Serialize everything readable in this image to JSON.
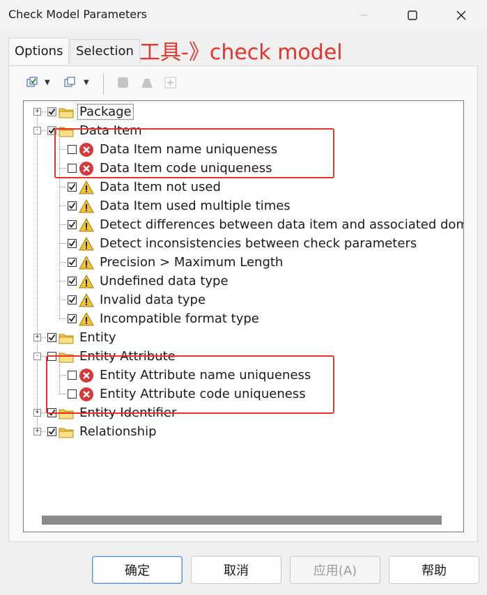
{
  "window": {
    "title": "Check Model Parameters",
    "controls": {
      "minimize": "—",
      "maximize": "☐",
      "close": "✕"
    }
  },
  "tabs": [
    {
      "label": "Options",
      "active": true
    },
    {
      "label": "Selection",
      "active": false
    }
  ],
  "annotation": "工具-》check model",
  "toolbar": {
    "items": [
      "check-all-icon",
      "uncheck-all-icon",
      "stop-icon",
      "triangle-icon",
      "add-icon"
    ]
  },
  "tree": {
    "nodes": [
      {
        "label": "Package",
        "type": "folder",
        "checked": "partial",
        "expander": "+"
      },
      {
        "label": "Data Item",
        "type": "folder",
        "checked": "partial",
        "expander": "−"
      },
      {
        "label": "Data Item name uniqueness",
        "type": "error",
        "checked": false
      },
      {
        "label": "Data Item code uniqueness",
        "type": "error",
        "checked": false
      },
      {
        "label": "Data Item not used",
        "type": "warning",
        "checked": true
      },
      {
        "label": "Data Item used multiple times",
        "type": "warning",
        "checked": true
      },
      {
        "label": "Detect differences between data item and associated domain",
        "type": "warning",
        "checked": true
      },
      {
        "label": "Detect inconsistencies between check parameters",
        "type": "warning",
        "checked": true
      },
      {
        "label": "Precision > Maximum Length",
        "type": "warning",
        "checked": true
      },
      {
        "label": "Undefined data type",
        "type": "warning",
        "checked": true
      },
      {
        "label": "Invalid data type",
        "type": "warning",
        "checked": true
      },
      {
        "label": "Incompatible format type",
        "type": "warning",
        "checked": true
      },
      {
        "label": "Entity",
        "type": "folder",
        "checked": true,
        "expander": "+"
      },
      {
        "label": "Entity Attribute",
        "type": "folder",
        "checked": false,
        "expander": "−"
      },
      {
        "label": "Entity Attribute name uniqueness",
        "type": "error",
        "checked": false
      },
      {
        "label": "Entity Attribute code uniqueness",
        "type": "error",
        "checked": false
      },
      {
        "label": "Entity Identifier",
        "type": "folder",
        "checked": true,
        "expander": "+"
      },
      {
        "label": "Relationship",
        "type": "folder",
        "checked": true,
        "expander": "+"
      }
    ]
  },
  "buttons": {
    "ok": "确定",
    "cancel": "取消",
    "apply": "应用(A)",
    "help": "帮助"
  },
  "colors": {
    "annotation_red": "#e8322a",
    "folder_yellow": "#f5c542",
    "error_red": "#d9373a",
    "warning_yellow": "#f2c230"
  }
}
